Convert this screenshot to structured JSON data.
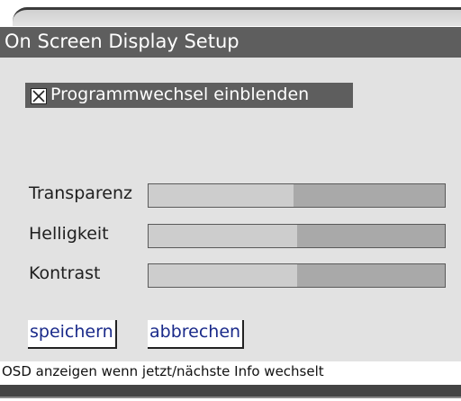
{
  "window": {
    "title": "On Screen Display Setup"
  },
  "checkbox": {
    "label": "Programmwechsel einblenden",
    "checked": true
  },
  "sliders": [
    {
      "label": "Transparenz",
      "value": 0.49
    },
    {
      "label": "Helligkeit",
      "value": 0.5
    },
    {
      "label": "Kontrast",
      "value": 0.5
    }
  ],
  "buttons": {
    "save": "speichern",
    "cancel": "abbrechen"
  },
  "status": {
    "text": "OSD anzeigen wenn jetzt/nächste Info wechselt"
  },
  "colors": {
    "title_bg": "#5e5e5e",
    "panel_bg": "#e2e2e2",
    "button_text": "#1a2a8a"
  }
}
